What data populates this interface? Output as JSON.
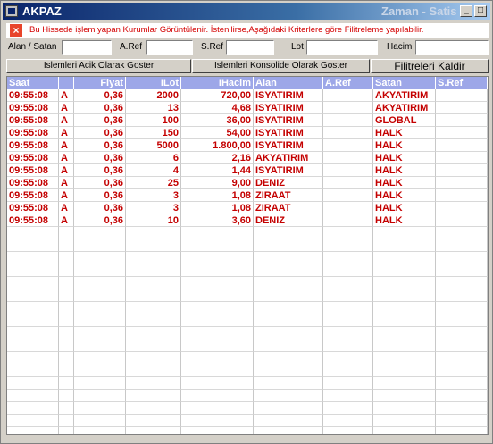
{
  "window": {
    "title": "AKPAZ",
    "subtitle": "Zaman - Satis",
    "min_glyph": "_",
    "max_glyph": "□",
    "close_glyph": "×"
  },
  "info": {
    "icon": "close-x-icon",
    "icon_glyph": "×",
    "message": "Bu Hissede işlem yapan Kurumlar Görüntülenir. İstenilirse,Aşağıdaki Kriterlere göre Filitreleme yapılabilir."
  },
  "filters": {
    "alan_satan": "Alan / Satan",
    "aref": "A.Ref",
    "sref": "S.Ref",
    "lot": "Lot",
    "hacim": "Hacim"
  },
  "buttons": {
    "open": "Islemleri Acik Olarak Goster",
    "consolidated": "Islemleri Konsolide Olarak Goster",
    "clear": "Filitreleri Kaldir"
  },
  "table": {
    "columns": [
      "Saat",
      "",
      "Fiyat",
      "ILot",
      "IHacim",
      "Alan",
      "A.Ref",
      "Satan",
      "S.Ref"
    ],
    "rows": [
      [
        "09:55:08",
        "A",
        "0,36",
        "2000",
        "720,00",
        "ISYATIRIM",
        "",
        "AKYATIRIM",
        ""
      ],
      [
        "09:55:08",
        "A",
        "0,36",
        "13",
        "4,68",
        "ISYATIRIM",
        "",
        "AKYATIRIM",
        ""
      ],
      [
        "09:55:08",
        "A",
        "0,36",
        "100",
        "36,00",
        "ISYATIRIM",
        "",
        "GLOBAL",
        ""
      ],
      [
        "09:55:08",
        "A",
        "0,36",
        "150",
        "54,00",
        "ISYATIRIM",
        "",
        "HALK",
        ""
      ],
      [
        "09:55:08",
        "A",
        "0,36",
        "5000",
        "1.800,00",
        "ISYATIRIM",
        "",
        "HALK",
        ""
      ],
      [
        "09:55:08",
        "A",
        "0,36",
        "6",
        "2,16",
        "AKYATIRIM",
        "",
        "HALK",
        ""
      ],
      [
        "09:55:08",
        "A",
        "0,36",
        "4",
        "1,44",
        "ISYATIRIM",
        "",
        "HALK",
        ""
      ],
      [
        "09:55:08",
        "A",
        "0,36",
        "25",
        "9,00",
        "DENIZ",
        "",
        "HALK",
        ""
      ],
      [
        "09:55:08",
        "A",
        "0,36",
        "3",
        "1,08",
        "ZIRAAT",
        "",
        "HALK",
        ""
      ],
      [
        "09:55:08",
        "A",
        "0,36",
        "3",
        "1,08",
        "ZIRAAT",
        "",
        "HALK",
        ""
      ],
      [
        "09:55:08",
        "A",
        "0,36",
        "10",
        "3,60",
        "DENIZ",
        "",
        "HALK",
        ""
      ]
    ]
  }
}
